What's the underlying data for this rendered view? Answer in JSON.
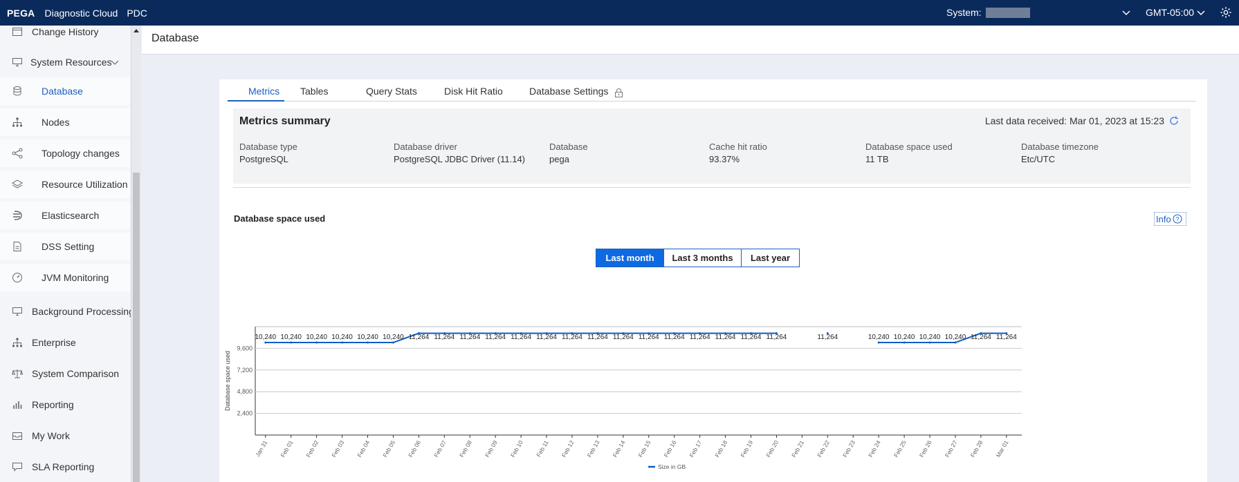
{
  "topbar": {
    "brand": "PEGA",
    "app": "Diagnostic Cloud",
    "env": "PDC",
    "system_label": "System:",
    "timezone": "GMT-05:00"
  },
  "sidebar": {
    "items": [
      {
        "label": "Change History",
        "icon": "calendar-icon"
      },
      {
        "label": "System Resources",
        "icon": "monitor-icon"
      },
      {
        "label": "Database",
        "icon": "database-icon",
        "active": true
      },
      {
        "label": "Nodes",
        "icon": "hierarchy-icon"
      },
      {
        "label": "Topology changes",
        "icon": "share-icon"
      },
      {
        "label": "Resource Utilization",
        "icon": "layers-icon"
      },
      {
        "label": "Elasticsearch",
        "icon": "elastic-icon"
      },
      {
        "label": "DSS Setting",
        "icon": "document-icon"
      },
      {
        "label": "JVM Monitoring",
        "icon": "gauge-icon"
      },
      {
        "label": "Background Processing",
        "icon": "monitor-icon"
      },
      {
        "label": "Enterprise",
        "icon": "hierarchy-icon"
      },
      {
        "label": "System Comparison",
        "icon": "scale-icon"
      },
      {
        "label": "Reporting",
        "icon": "bar-chart-icon"
      },
      {
        "label": "My Work",
        "icon": "inbox-icon"
      },
      {
        "label": "SLA Reporting",
        "icon": "chat-icon"
      }
    ]
  },
  "page": {
    "title": "Database"
  },
  "tabs": [
    "Metrics",
    "Tables",
    "Query Stats",
    "Disk Hit Ratio",
    "Database Settings"
  ],
  "summary": {
    "title": "Metrics summary",
    "last_data_label": "Last data received:",
    "last_data_value": "Mar 01, 2023 at 15:23",
    "metrics": [
      {
        "key": "Database type",
        "value": "PostgreSQL"
      },
      {
        "key": "Database driver",
        "value": "PostgreSQL JDBC Driver (11.14)"
      },
      {
        "key": "Database",
        "value": "pega"
      },
      {
        "key": "Cache hit ratio",
        "value": "93.37%"
      },
      {
        "key": "Database space used",
        "value": "11 TB"
      },
      {
        "key": "Database timezone",
        "value": "Etc/UTC"
      }
    ]
  },
  "chart_section": {
    "title": "Database space used",
    "info_label": "Info",
    "ranges": [
      "Last month",
      "Last 3 months",
      "Last year"
    ],
    "active_range": "Last month"
  },
  "chart_data": {
    "type": "line",
    "ylabel": "Database space used",
    "yticks": [
      "2,400",
      "4,800",
      "7,200",
      "9,600"
    ],
    "ylim": [
      0,
      12000
    ],
    "legend": "Size in GB",
    "grid": true,
    "color": "#0b5cc7",
    "categories": [
      "Jan 31",
      "Feb 01",
      "Feb 02",
      "Feb 03",
      "Feb 04",
      "Feb 05",
      "Feb 06",
      "Feb 07",
      "Feb 08",
      "Feb 09",
      "Feb 10",
      "Feb 11",
      "Feb 12",
      "Feb 13",
      "Feb 14",
      "Feb 15",
      "Feb 16",
      "Feb 17",
      "Feb 18",
      "Feb 19",
      "Feb 20",
      "Feb 21",
      "Feb 22",
      "Feb 23",
      "Feb 24",
      "Feb 25",
      "Feb 26",
      "Feb 27",
      "Feb 28",
      "Mar 01"
    ],
    "values": [
      10240,
      10240,
      10240,
      10240,
      10240,
      10240,
      11264,
      11264,
      11264,
      11264,
      11264,
      11264,
      11264,
      11264,
      11264,
      11264,
      11264,
      11264,
      11264,
      11264,
      11264,
      null,
      11264,
      null,
      10240,
      10240,
      10240,
      10240,
      11264,
      11264
    ],
    "labels": [
      "10,240",
      "10,240",
      "10,240",
      "10,240",
      "10,240",
      "10,240",
      "11,264",
      "11,264",
      "11,264",
      "11,264",
      "11,264",
      "11,264",
      "11,264",
      "11,264",
      "11,264",
      "11,264",
      "11,264",
      "11,264",
      "11,264",
      "11,264",
      "11,264",
      "",
      "11,264",
      "",
      "10,240",
      "10,240",
      "10,240",
      "10,240",
      "11,264",
      "11,264"
    ]
  }
}
